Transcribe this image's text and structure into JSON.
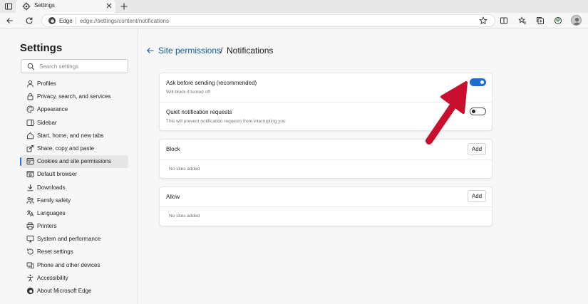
{
  "browser": {
    "tab_title": "Settings",
    "site_name": "Edge",
    "url": "edge://settings/content/notifications"
  },
  "sidebar": {
    "title": "Settings",
    "search_placeholder": "Search settings",
    "items": [
      {
        "label": "Profiles",
        "icon": "profile-icon"
      },
      {
        "label": "Privacy, search, and services",
        "icon": "lock-icon"
      },
      {
        "label": "Appearance",
        "icon": "appearance-icon"
      },
      {
        "label": "Sidebar",
        "icon": "sidebar-icon"
      },
      {
        "label": "Start, home, and new tabs",
        "icon": "home-icon"
      },
      {
        "label": "Share, copy and paste",
        "icon": "share-icon"
      },
      {
        "label": "Cookies and site permissions",
        "icon": "cookies-icon",
        "active": true
      },
      {
        "label": "Default browser",
        "icon": "browser-icon"
      },
      {
        "label": "Downloads",
        "icon": "download-icon"
      },
      {
        "label": "Family safety",
        "icon": "family-icon"
      },
      {
        "label": "Languages",
        "icon": "language-icon"
      },
      {
        "label": "Printers",
        "icon": "printer-icon"
      },
      {
        "label": "System and performance",
        "icon": "system-icon"
      },
      {
        "label": "Reset settings",
        "icon": "reset-icon"
      },
      {
        "label": "Phone and other devices",
        "icon": "phone-icon"
      },
      {
        "label": "Accessibility",
        "icon": "accessibility-icon"
      },
      {
        "label": "About Microsoft Edge",
        "icon": "edge-icon"
      }
    ]
  },
  "main": {
    "breadcrumb_link": "Site permissions",
    "breadcrumb_sep": "/",
    "breadcrumb_current": "Notifications",
    "ask_title": "Ask before sending (recommended)",
    "ask_sub": "Will block if turned off",
    "ask_on": true,
    "quiet_title": "Quiet notification requests",
    "quiet_sub": "This will prevent notification requests from interrupting you",
    "quiet_on": false,
    "block_title": "Block",
    "block_add": "Add",
    "block_empty": "No sites added",
    "allow_title": "Allow",
    "allow_add": "Add",
    "allow_empty": "No sites added"
  },
  "colors": {
    "accent": "#1a6fd1",
    "link": "#115ea3",
    "annotation_arrow": "#c8102e"
  }
}
